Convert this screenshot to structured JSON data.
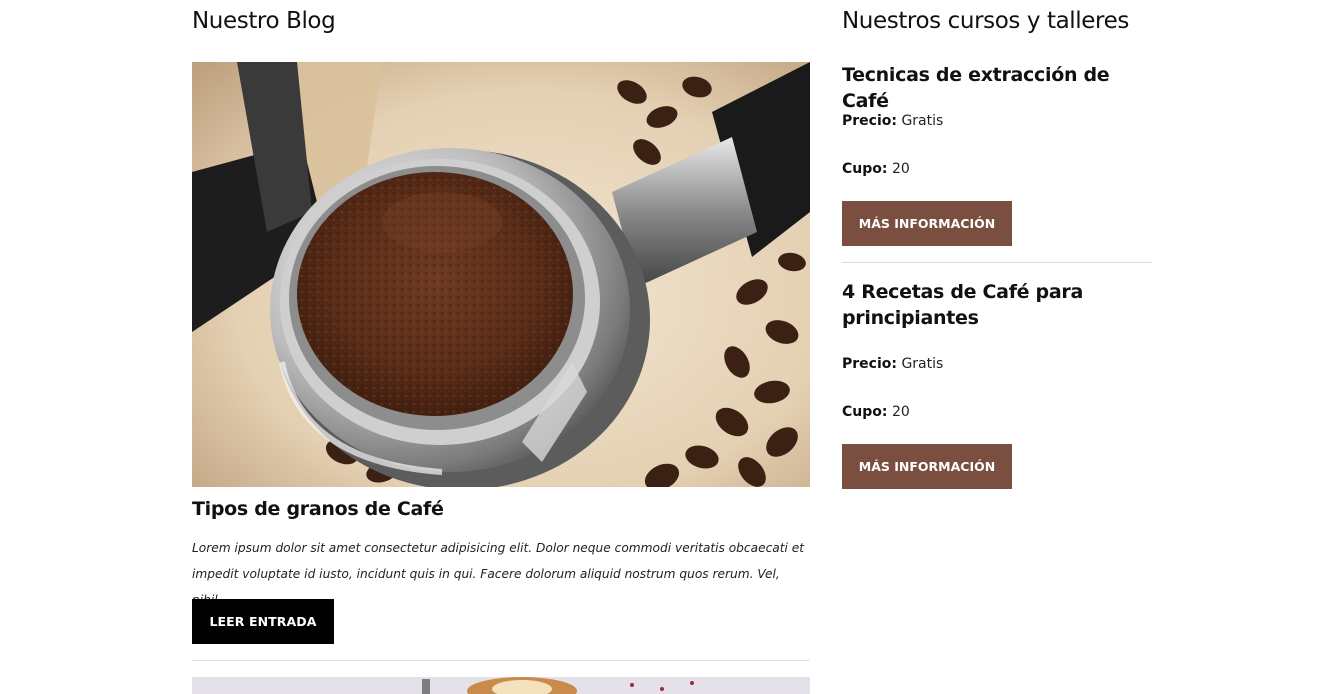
{
  "blog": {
    "heading": "Nuestro Blog",
    "post": {
      "title": "Tipos de granos de Café",
      "excerpt": "Lorem ipsum dolor sit amet consectetur adipisicing elit. Dolor neque commodi veritatis obcaecati et impedit voluptate id iusto, incidunt quis in qui. Facere dolorum aliquid nostrum quos rerum. Vel, nihil.",
      "button_label": "LEER ENTRADA",
      "image": "coffee-portafilter-photo"
    },
    "next_post_image": "coffee-dessert-photo"
  },
  "courses": {
    "heading": "Nuestros cursos y talleres",
    "items": [
      {
        "title": "Tecnicas de extracción de Café",
        "price_label": "Precio:",
        "price_value": "Gratis",
        "cupo_label": "Cupo:",
        "cupo_value": "20",
        "button_label": "MÁS INFORMACIÓN"
      },
      {
        "title": "4 Recetas de Café para principiantes",
        "price_label": "Precio:",
        "price_value": "Gratis",
        "cupo_label": "Cupo:",
        "cupo_value": "20",
        "button_label": "MÁS INFORMACIÓN"
      }
    ]
  },
  "colors": {
    "button_primary": "#000000",
    "button_accent": "#7a4f40",
    "text": "#111111"
  }
}
